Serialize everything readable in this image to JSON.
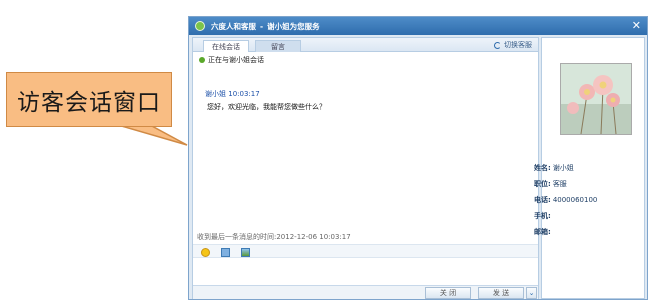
{
  "callout": {
    "text": "访客会话窗口"
  },
  "window": {
    "title_left": "六度人和客服",
    "title_sep": "-",
    "title_right": "谢小姐为您服务",
    "close_glyph": "✕"
  },
  "tabs": [
    {
      "label": "在线会话",
      "active": true
    },
    {
      "label": "留言",
      "active": false
    }
  ],
  "switch_agent": "切换客服",
  "status_line": "正在与谢小姐会话",
  "messages": [
    {
      "sender": "谢小姐",
      "time": "10:03:17",
      "text": "您好，欢迎光临，我能帮您做些什么？"
    }
  ],
  "last_msg_time": "收到最后一条消息的时间:2012-12-06 10:03:17",
  "toolbar_icons": [
    "emoji-icon",
    "note-icon",
    "image-icon"
  ],
  "buttons": {
    "close": "关 闭",
    "send": "发 送",
    "drop": "⌄"
  },
  "profile": [
    {
      "key": "姓名:",
      "value": "谢小姐"
    },
    {
      "key": "职位:",
      "value": "客服"
    },
    {
      "key": "电话:",
      "value": "4000060100"
    },
    {
      "key": "手机:",
      "value": ""
    },
    {
      "key": "邮箱:",
      "value": ""
    }
  ],
  "colors": {
    "title_bar": "#2f6dad",
    "callout_fill": "#f9bd83",
    "sender_blue": "#1b4fa8",
    "online_green": "#5aa82a"
  }
}
